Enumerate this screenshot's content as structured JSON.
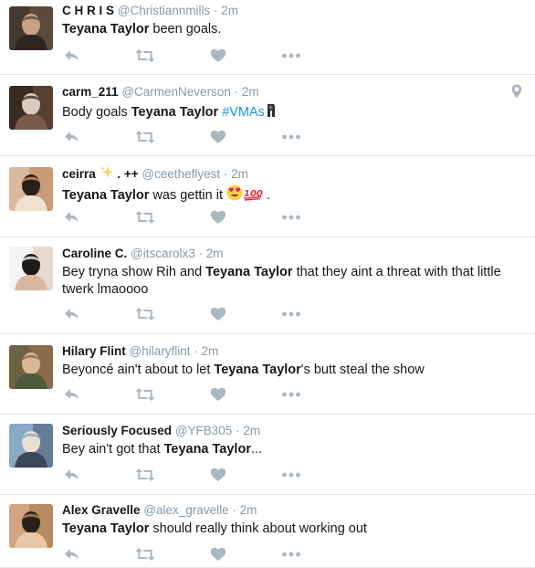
{
  "tweets": [
    {
      "name": "C H R I S",
      "handle": "@Christiannmills",
      "time": "2m",
      "text_parts": [
        {
          "t": "Teyana Taylor",
          "bold": true
        },
        {
          "t": " been goals."
        }
      ],
      "avatar_colors": [
        "#5a4a3c",
        "#c8a286",
        "#2d2420"
      ]
    },
    {
      "name": "carm_211",
      "handle": "@CarmenNeverson",
      "time": "2m",
      "text_parts": [
        {
          "t": "Body goals "
        },
        {
          "t": "Teyana Taylor",
          "bold": true
        },
        {
          "t": " "
        },
        {
          "t": "#VMAs",
          "hashtag": true
        }
      ],
      "has_location_pin": true,
      "avatar_colors": [
        "#3b2a22",
        "#d8c8c0",
        "#7a5a48"
      ]
    },
    {
      "name": "ceirra",
      "name_suffix": ". ++",
      "handle": "@ceetheflyest",
      "time": "2m",
      "text_parts": [
        {
          "t": "Teyana Taylor",
          "bold": true
        },
        {
          "t": " was gettin it "
        }
      ],
      "text_tail": ".",
      "avatar_colors": [
        "#c89a76",
        "#2a1e18",
        "#f0e0d0"
      ]
    },
    {
      "name": "Caroline C.",
      "handle": "@itscarolx3",
      "time": "2m",
      "text_parts": [
        {
          "t": "Bey tryna show Rih and "
        },
        {
          "t": "Teyana Taylor",
          "bold": true
        },
        {
          "t": " that they aint a threat with that little twerk lmaoooo"
        }
      ],
      "avatar_colors": [
        "#f4f4f4",
        "#1e1a18",
        "#d8b8a0"
      ]
    },
    {
      "name": "Hilary Flint",
      "handle": "@hilaryflint",
      "time": "2m",
      "text_parts": [
        {
          "t": "Beyoncé ain't about to let "
        },
        {
          "t": "Teyana Taylor",
          "bold": true
        },
        {
          "t": "'s butt steal the show"
        }
      ],
      "avatar_colors": [
        "#8a6a4a",
        "#d8b898",
        "#4a5a3a"
      ]
    },
    {
      "name": "Seriously Focused",
      "handle": "@YFB305",
      "time": "2m",
      "text_parts": [
        {
          "t": "Bey ain't got that "
        },
        {
          "t": "Teyana Taylor",
          "bold": true
        },
        {
          "t": "..."
        }
      ],
      "avatar_colors": [
        "#8aa8c8",
        "#e8e0d0",
        "#3a4858"
      ]
    },
    {
      "name": "Alex Gravelle",
      "handle": "@alex_gravelle",
      "time": "2m",
      "text_parts": [
        {
          "t": "Teyana Taylor",
          "bold": true
        },
        {
          "t": " should really think about working out"
        }
      ],
      "avatar_colors": [
        "#b88a60",
        "#2a2018",
        "#e8c8a8"
      ]
    }
  ],
  "separator": "·",
  "icon_color": "#aab8c2"
}
